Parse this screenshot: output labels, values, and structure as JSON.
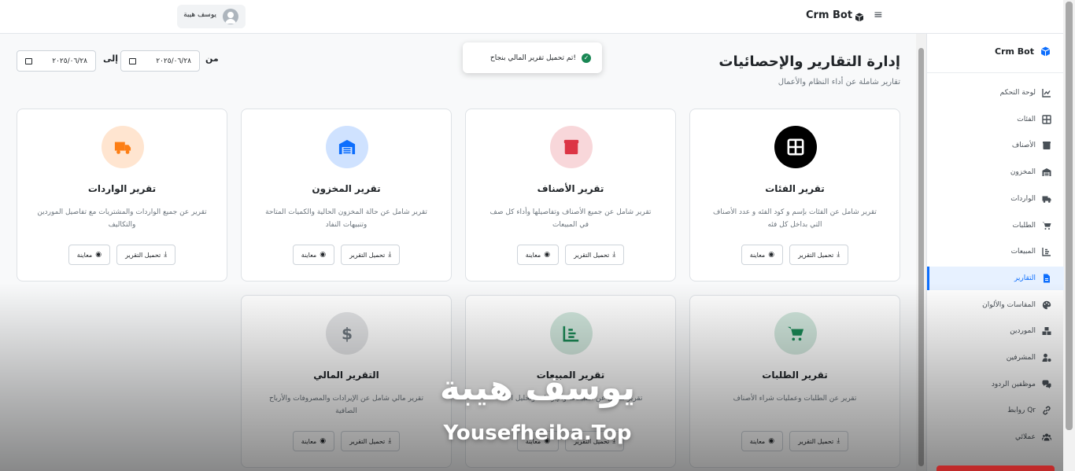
{
  "topbar": {
    "brand": "Crm Bot",
    "menu_icon": "hamburger-icon",
    "user_name": "يوسف هيبة"
  },
  "sidebar": {
    "brand": "Crm Bot",
    "items": [
      {
        "label": "لوحة التحكم",
        "icon": "chart-line-icon"
      },
      {
        "label": "الفئات",
        "icon": "grid-icon"
      },
      {
        "label": "الأصناف",
        "icon": "box-icon"
      },
      {
        "label": "المخزون",
        "icon": "warehouse-icon"
      },
      {
        "label": "الواردات",
        "icon": "truck-icon"
      },
      {
        "label": "الطلبات",
        "icon": "cart-icon"
      },
      {
        "label": "المبيعات",
        "icon": "sales-chart-icon"
      },
      {
        "label": "التقارير",
        "icon": "file-report-icon",
        "active": true
      },
      {
        "label": "المقاسات والألوان",
        "icon": "palette-icon"
      },
      {
        "label": "الموردين",
        "icon": "boxes-icon"
      },
      {
        "label": "المشرفين",
        "icon": "user-gear-icon"
      },
      {
        "label": "موظفين الردود",
        "icon": "comments-icon"
      },
      {
        "label": "روابط Qr",
        "icon": "link-icon"
      },
      {
        "label": "عملائي",
        "icon": "users-icon"
      }
    ]
  },
  "header": {
    "title": "إدارة التقارير والإحصائيات",
    "subtitle": "تقارير شاملة عن أداء النظام والأعمال",
    "from_label": "من",
    "to_label": "إلى",
    "from_date": "٢٠٢٥/٠٦/٢٨",
    "to_date": "٢٠٢٥/٠٦/٢٨"
  },
  "toast": {
    "message": "تم تحميل تقرير المالي بنجاح!"
  },
  "buttons": {
    "download": "تحميل التقرير",
    "preview": "معاينة"
  },
  "cards": [
    {
      "title": "تقرير الفئات",
      "desc": "تقرير شامل عن الفئات بإسم و كود الفئه و عدد الأصناف التي بداخل كل فئه",
      "icon": "grid-icon",
      "color": "#000000"
    },
    {
      "title": "تقرير الأصناف",
      "desc": "تقرير شامل عن جميع الأصناف وتفاصيلها وأداء كل صف في المبيعات",
      "icon": "box-icon",
      "color": "#dc3545"
    },
    {
      "title": "تقرير المخزون",
      "desc": "تقرير شامل عن حالة المخزون الحالية والكميات المتاحة وتنبيهات النفاد",
      "icon": "warehouse-icon",
      "color": "#0d6efd"
    },
    {
      "title": "تقرير الواردات",
      "desc": "تقرير عن جميع الواردات والمشتريات مع تفاصيل الموردين والتكاليف",
      "icon": "truck-icon",
      "color": "#fd7e14"
    },
    {
      "title": "تقرير الطلبات",
      "desc": "تقرير عن الطلبات وعمليات شراء الأصناف",
      "icon": "cart-icon",
      "color": "#198754"
    },
    {
      "title": "تقرير المبيعات",
      "desc": "تقرير شامل عن المبيعات والإيرادات وتحليل الأداء",
      "icon": "sales-chart-icon",
      "color": "#198754"
    },
    {
      "title": "التقرير المالي",
      "desc": "تقرير مالي شامل عن الإيرادات والمصروفات والأرباح الصافية",
      "icon": "dollar-icon",
      "color": "#6c757d"
    }
  ],
  "watermark": {
    "arabic": "يوسف هيبة",
    "english": "Yousefheiba.Top"
  }
}
